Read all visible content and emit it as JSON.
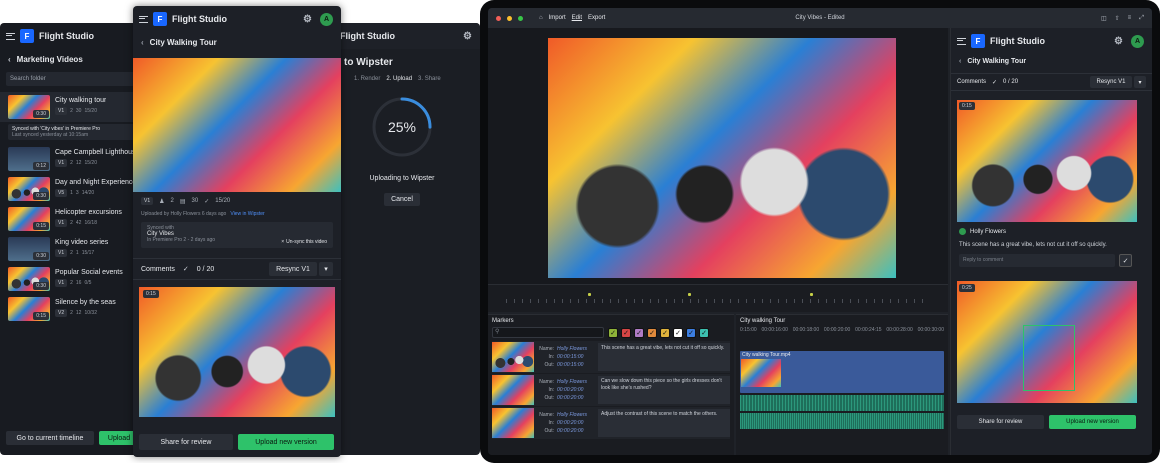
{
  "panel1": {
    "app_name": "Flight Studio",
    "title": "Marketing Videos",
    "search_placeholder": "Search folder",
    "items": [
      {
        "title": "City walking tour",
        "duration": "0:30",
        "version": "V1",
        "people": "2",
        "comments": "30",
        "tasks": "15/20"
      },
      {
        "title": "Cape Campbell Lighthouse",
        "duration": "0:12",
        "version": "V1",
        "people": "2",
        "comments": "12",
        "tasks": "15/20"
      },
      {
        "title": "Day and Night Experience",
        "duration": "0:30",
        "version": "V5",
        "people": "1",
        "comments": "3",
        "tasks": "14/20"
      },
      {
        "title": "Helicopter excursions",
        "duration": "0:15",
        "version": "V1",
        "people": "2",
        "comments": "42",
        "tasks": "16/18"
      },
      {
        "title": "King video series",
        "duration": "0:30",
        "version": "V1",
        "people": "2",
        "comments": "1",
        "tasks": "15/17"
      },
      {
        "title": "Popular Social events",
        "duration": "0:30",
        "version": "V1",
        "people": "2",
        "comments": "16",
        "tasks": "0/5"
      },
      {
        "title": "Silence by the seas",
        "duration": "0:15",
        "version": "V2",
        "people": "2",
        "comments": "12",
        "tasks": "10/32"
      }
    ],
    "sync_line1": "Synced with 'City vibes' in Premiere Pro",
    "sync_line2": "Last synced yesterday at 10:15am",
    "goto_label": "Go to current timeline",
    "upload_label": "Upload"
  },
  "panel2": {
    "app_name": "Flight Studio",
    "avatar": "A",
    "title": "City Walking Tour",
    "version": "V1",
    "people": "2",
    "comments": "30",
    "tasks": "15/20",
    "uploaded_by": "Uploaded by Holly Flowers 6 days ago",
    "view_link": "View in Wipster",
    "synced_with": "Synced with",
    "synced_name": "City Vibes",
    "synced_sub": "In Premiere Pro 2 - 2 days ago",
    "unsync_label": "Un-sync this video",
    "comments_label": "Comments",
    "comments_count": "0 / 20",
    "resync_label": "Resync V1",
    "clip_time": "0:15",
    "share_label": "Share for review",
    "upload_label": "Upload new version"
  },
  "panel3": {
    "app_name": "Flight Studio",
    "title": "to Wipster",
    "steps": [
      "1. Render",
      "2. Upload",
      "3. Share"
    ],
    "progress_value": 25,
    "progress_text": "25%",
    "status": "Uploading to Wipster",
    "cancel_label": "Cancel"
  },
  "editor": {
    "menu": [
      "Import",
      "Edit",
      "Export"
    ],
    "window_title": "City Vibes - Edited",
    "markers_title": "Markers",
    "markers": [
      {
        "name_label": "Name:",
        "name": "Holly Flowers",
        "in_label": "In:",
        "in": "00:00:15:00",
        "out_label": "Out:",
        "out": "00:00:15:00",
        "comment": "This scene has a great vibe, lets not cut it off so quickly."
      },
      {
        "name_label": "Name:",
        "name": "Holly Flowers",
        "in_label": "In:",
        "in": "00:00:20:00",
        "out_label": "Out:",
        "out": "00:00:20:00",
        "comment": "Can we slow down this piece so the girls dresses don't look like she’s rushed?"
      },
      {
        "name_label": "Name:",
        "name": "Holly Flowers",
        "in_label": "In:",
        "in": "00:00:20:00",
        "out_label": "Out:",
        "out": "00:00:20:00",
        "comment": "Adjust the contrast of this scene to match the others."
      }
    ],
    "label_colors": [
      "#8fb339",
      "#d64545",
      "#b07cc6",
      "#e08a3c",
      "#e0b43c",
      "#ffffff",
      "#3c7ee0",
      "#3cc0b0"
    ],
    "timeline_title": "City walking Tour",
    "timecodes": [
      "0:15:00",
      "00:00:16:00",
      "00:00:18:00",
      "00:00:20:00",
      "00:00:24:15",
      "00:00:28:00",
      "00:00:30:00"
    ],
    "clip_label": "City walking Tour.mp4"
  },
  "panel4": {
    "app_name": "Flight Studio",
    "avatar": "A",
    "title": "City Walking Tour",
    "comments_label": "Comments",
    "comments_count": "0 / 20",
    "resync_label": "Resync V1",
    "thumb_time": "0:15",
    "commenter": "Holly Flowers",
    "comment_text": "This scene has a great vibe, lets not cut it off so quickly.",
    "reply_placeholder": "Reply to comment",
    "thumb2_time": "0:25",
    "share_label": "Share for review",
    "upload_label": "Upload new version"
  },
  "colors": {
    "accent": "#1967ff",
    "green": "#2ec26a",
    "progress": "#3a8dde"
  }
}
